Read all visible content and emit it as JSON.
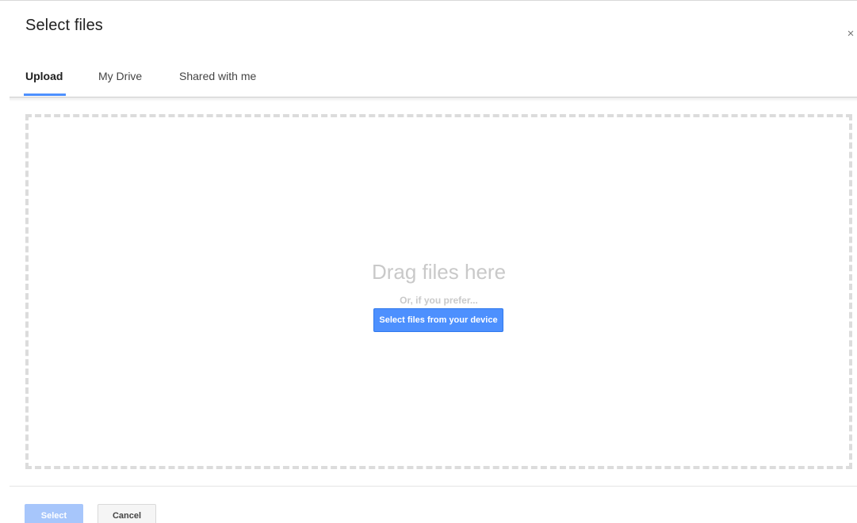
{
  "dialog": {
    "title": "Select files",
    "close_glyph": "×"
  },
  "tabs": [
    {
      "label": "Upload",
      "active": true
    },
    {
      "label": "My Drive",
      "active": false
    },
    {
      "label": "Shared with me",
      "active": false
    }
  ],
  "dropzone": {
    "heading": "Drag files here",
    "subtext": "Or, if you prefer...",
    "device_button_label": "Select files from your device"
  },
  "footer": {
    "select_label": "Select",
    "cancel_label": "Cancel"
  },
  "colors": {
    "accent": "#4d90fe",
    "select_disabled": "#a7c6fb",
    "dropzone_border": "#dcdcdc"
  },
  "icons": {
    "close": "close-icon"
  }
}
